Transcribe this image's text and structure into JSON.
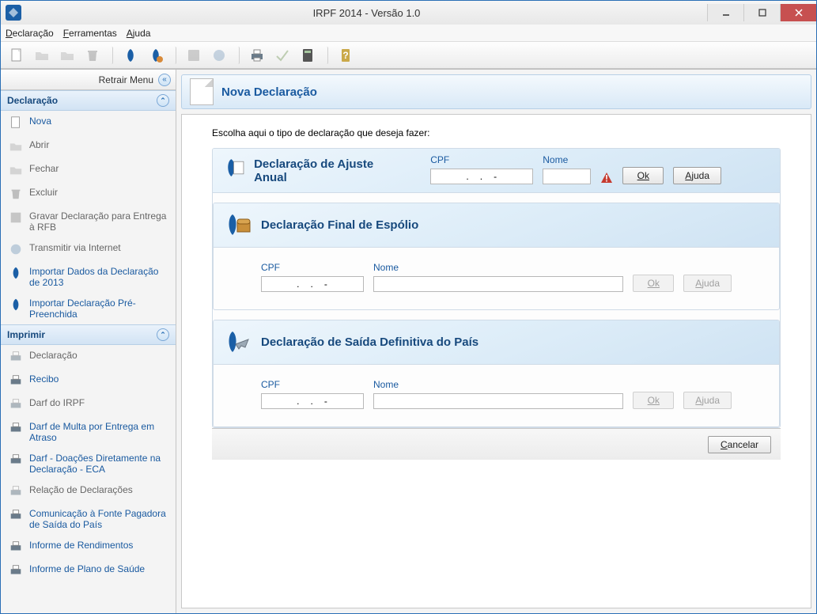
{
  "window": {
    "title": "IRPF 2014 - Versão 1.0"
  },
  "menubar": {
    "declaracao": "Declaração",
    "ferramentas": "Ferramentas",
    "ajuda": "Ajuda"
  },
  "retrair_label": "Retrair Menu",
  "sidebar": {
    "section_declaracao": "Declaração",
    "section_imprimir": "Imprimir",
    "items_decl": [
      {
        "label": "Nova",
        "enabled": true
      },
      {
        "label": "Abrir",
        "enabled": false
      },
      {
        "label": "Fechar",
        "enabled": false
      },
      {
        "label": "Excluir",
        "enabled": false
      },
      {
        "label": "Gravar Declaração para Entrega à RFB",
        "enabled": false
      },
      {
        "label": "Transmitir via Internet",
        "enabled": false
      },
      {
        "label": "Importar Dados da Declaração de 2013",
        "enabled": true
      },
      {
        "label": "Importar Declaração Pré-Preenchida",
        "enabled": true
      }
    ],
    "items_print": [
      {
        "label": "Declaração",
        "enabled": false
      },
      {
        "label": "Recibo",
        "enabled": true
      },
      {
        "label": "Darf do IRPF",
        "enabled": false
      },
      {
        "label": "Darf de Multa por Entrega em Atraso",
        "enabled": true
      },
      {
        "label": "Darf - Doações Diretamente na Declaração - ECA",
        "enabled": true
      },
      {
        "label": "Relação de Declarações",
        "enabled": false
      },
      {
        "label": "Comunicação à Fonte Pagadora de Saída do País",
        "enabled": true
      },
      {
        "label": "Informe de Rendimentos",
        "enabled": true
      },
      {
        "label": "Informe de Plano de Saúde",
        "enabled": true
      }
    ]
  },
  "page": {
    "title": "Nova Declaração",
    "prompt": "Escolha aqui o tipo de declaração que deseja fazer:"
  },
  "cards": {
    "ajuste": {
      "title": "Declaração de Ajuste Anual",
      "cpf_label": "CPF",
      "nome_label": "Nome",
      "cpf_mask": ".   .   -",
      "ok": "Ok",
      "ajuda": "Ajuda",
      "enabled": true
    },
    "espolio": {
      "title": "Declaração Final de Espólio",
      "cpf_label": "CPF",
      "nome_label": "Nome",
      "cpf_mask": ".   .   -",
      "ok": "Ok",
      "ajuda": "Ajuda",
      "enabled": false
    },
    "saida": {
      "title": "Declaração de Saída Definitiva do País",
      "cpf_label": "CPF",
      "nome_label": "Nome",
      "cpf_mask": ".   .   -",
      "ok": "Ok",
      "ajuda": "Ajuda",
      "enabled": false
    }
  },
  "footer": {
    "cancelar": "Cancelar"
  }
}
